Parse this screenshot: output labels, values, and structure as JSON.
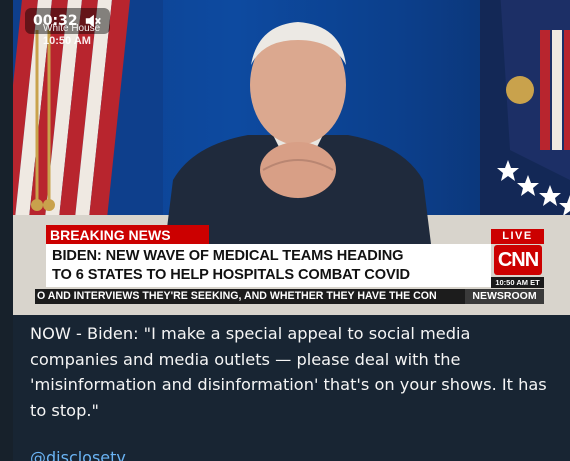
{
  "video": {
    "timestamp": "00:32",
    "location": "White House",
    "location_time": "10:50 AM",
    "breaking_label": "BREAKING NEWS",
    "headline_line1": "BIDEN: NEW WAVE OF MEDICAL TEAMS HEADING",
    "headline_line2": "TO 6 STATES TO HELP HOSPITALS COMBAT COVID",
    "live_label": "LIVE",
    "network_logo": "CNN",
    "network_time": "10:50 AM ET",
    "ticker_text": "O AND INTERVIEWS THEY'RE SEEKING, AND WHETHER THEY HAVE THE CON",
    "show_name": "NEWSROOM",
    "muted_icon": "speaker-muted-icon"
  },
  "post": {
    "caption": "NOW - Biden: \"I make a special appeal to social media companies and media outlets — please deal with the 'misinformation and disinformation' that's on your shows. It has to stop.\"",
    "link_partial": "@disclosetv"
  },
  "colors": {
    "background": "#17212b",
    "bubble": "#182533",
    "cnn_red": "#cc0000",
    "link": "#6ab3f3"
  }
}
